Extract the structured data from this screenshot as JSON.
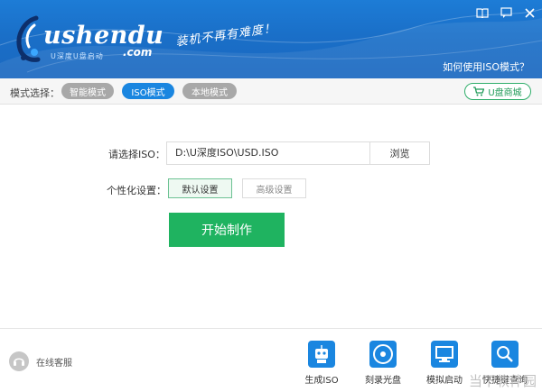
{
  "colors": {
    "header_blue": "#1a6fc8",
    "accent_blue": "#1a86e0",
    "green": "#1fb360",
    "pill_gray": "#a8a8a8"
  },
  "header": {
    "logo_main": "ushendu",
    "logo_com": ".com",
    "logo_sub": "U深度U盘启动",
    "slogan": "装机不再有难度！",
    "help_link": "如何使用ISO模式？",
    "icons": [
      "book-icon",
      "chat-icon",
      "close-icon"
    ]
  },
  "modebar": {
    "label": "模式选择：",
    "modes": [
      {
        "label": "智能模式",
        "active": false
      },
      {
        "label": "ISO模式",
        "active": true
      },
      {
        "label": "本地模式",
        "active": false
      }
    ],
    "shop_label": "U盘商城"
  },
  "form": {
    "iso_label": "请选择ISO：",
    "iso_value": "D:\\U深度ISO\\USD.ISO",
    "browse_label": "浏览",
    "custom_label": "个性化设置：",
    "default_setting": "默认设置",
    "advanced_setting": "高级设置",
    "start_label": "开始制作"
  },
  "footer": {
    "service_label": "在线客服",
    "tools": [
      {
        "label": "生成ISO",
        "icon": "robot-icon"
      },
      {
        "label": "刻录光盘",
        "icon": "disc-icon"
      },
      {
        "label": "模拟启动",
        "icon": "monitor-icon"
      },
      {
        "label": "快捷键查询",
        "icon": "magnifier-icon"
      }
    ],
    "watermark": "当下软件园"
  }
}
